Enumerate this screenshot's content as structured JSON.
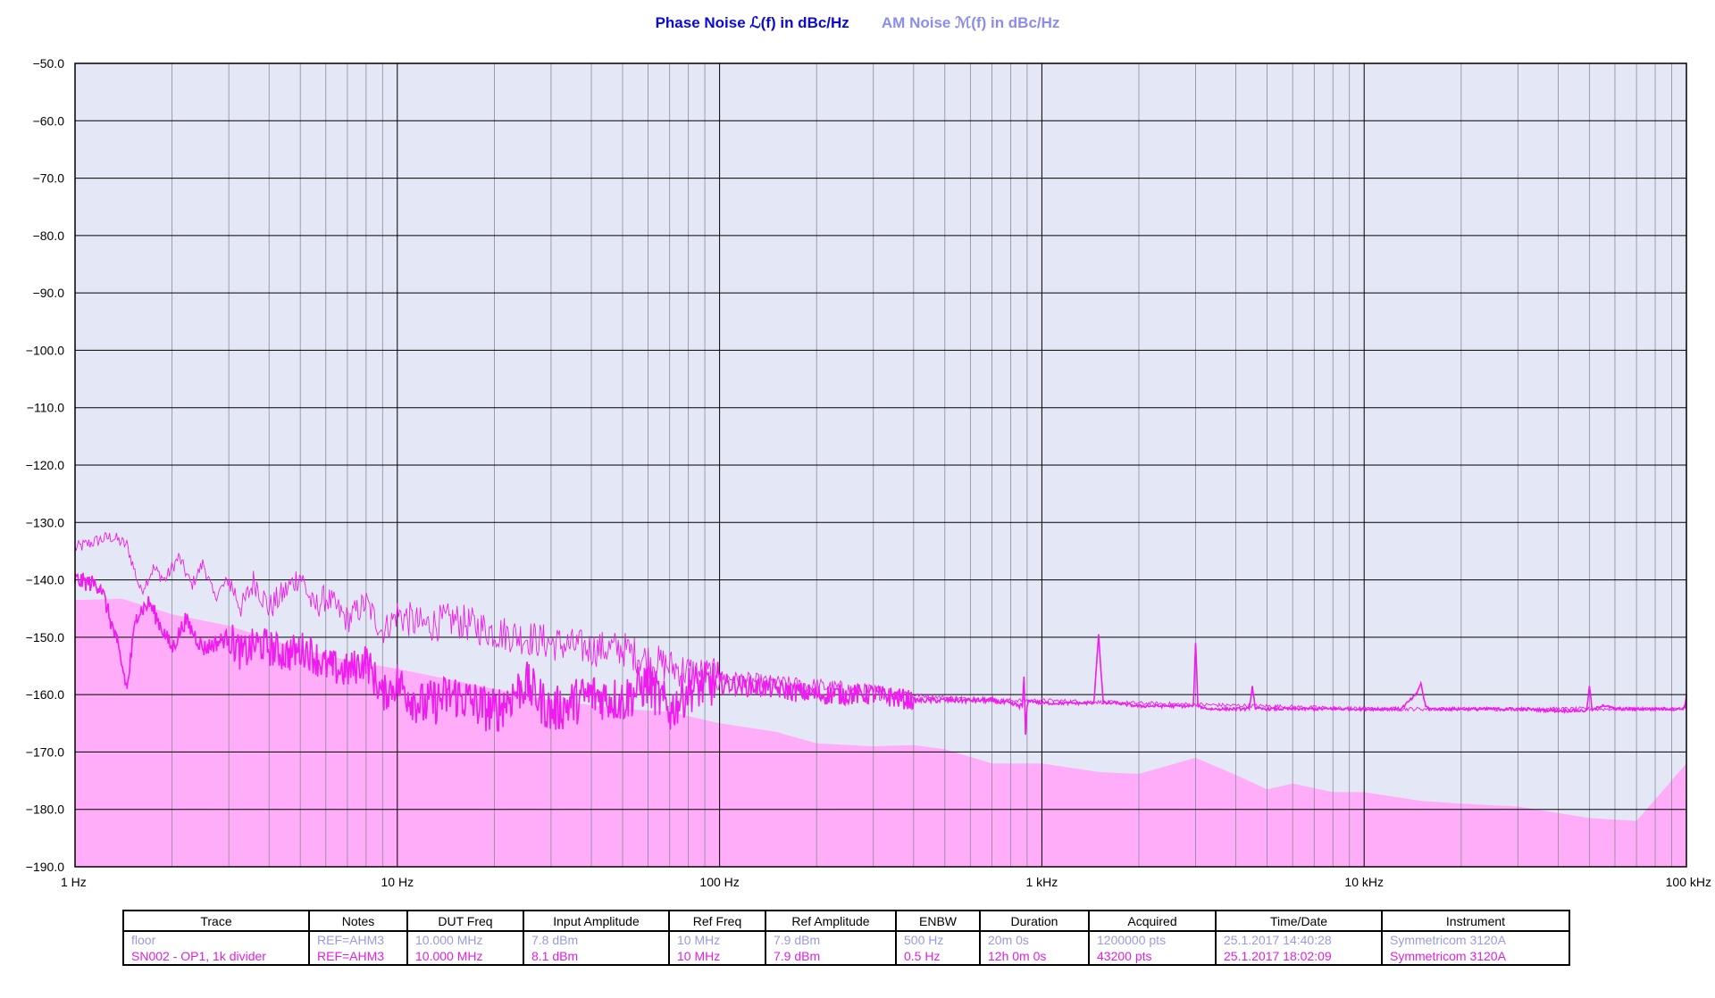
{
  "titles": {
    "phase_noise": "Phase Noise ℒ(f) in dBc/Hz",
    "am_noise": "AM Noise ℳ(f) in dBc/Hz"
  },
  "colors": {
    "phase_title": "#0a0ad8",
    "am_title": "#8c8cf0",
    "plot_bg": "#e4e8f6",
    "floor_fill": "#ffadf8",
    "trace": "#ee1cee",
    "grid": "#000000"
  },
  "chart_data": {
    "type": "line",
    "x_scale": "log",
    "xlim": [
      1,
      100000
    ],
    "ylim": [
      -190,
      -50
    ],
    "x_ticks": [
      {
        "value": 1,
        "label": "1 Hz"
      },
      {
        "value": 10,
        "label": "10 Hz"
      },
      {
        "value": 100,
        "label": "100 Hz"
      },
      {
        "value": 1000,
        "label": "1 kHz"
      },
      {
        "value": 10000,
        "label": "10 kHz"
      },
      {
        "value": 100000,
        "label": "100 kHz"
      }
    ],
    "y_ticks": [
      {
        "value": -50,
        "label": "−50.0"
      },
      {
        "value": -60,
        "label": "−60.0"
      },
      {
        "value": -70,
        "label": "−70.0"
      },
      {
        "value": -80,
        "label": "−80.0"
      },
      {
        "value": -90,
        "label": "−90.0"
      },
      {
        "value": -100,
        "label": "−100.0"
      },
      {
        "value": -110,
        "label": "−110.0"
      },
      {
        "value": -120,
        "label": "−120.0"
      },
      {
        "value": -130,
        "label": "−130.0"
      },
      {
        "value": -140,
        "label": "−140.0"
      },
      {
        "value": -150,
        "label": "−150.0"
      },
      {
        "value": -160,
        "label": "−160.0"
      },
      {
        "value": -170,
        "label": "−170.0"
      },
      {
        "value": -180,
        "label": "−180.0"
      },
      {
        "value": -190,
        "label": "−190.0"
      }
    ],
    "grid": true,
    "series": [
      {
        "name": "floor",
        "style": "filled-area",
        "x": [
          1,
          1.4,
          2,
          3,
          5,
          7,
          10,
          15,
          20,
          30,
          50,
          70,
          100,
          150,
          200,
          300,
          400,
          500,
          700,
          1000,
          1500,
          2000,
          3000,
          4000,
          5000,
          6000,
          8000,
          10000,
          15000,
          20000,
          30000,
          50000,
          70000,
          100000
        ],
        "y": [
          -143.5,
          -143.3,
          -146,
          -148,
          -152,
          -154,
          -155.5,
          -157.5,
          -159,
          -161,
          -162.5,
          -163,
          -165,
          -166.5,
          -168.5,
          -169,
          -168.8,
          -169.5,
          -172,
          -172,
          -173.5,
          -173.8,
          -171,
          -174,
          -176.5,
          -175.5,
          -177,
          -177,
          -178.5,
          -179,
          -179.5,
          -181.5,
          -182,
          -172
        ]
      },
      {
        "name": "SN002 - OP1, 1k divider",
        "style": "line",
        "x": [
          1,
          1.2,
          1.35,
          1.45,
          1.55,
          1.7,
          2,
          2.2,
          2.5,
          3,
          3.3,
          3.7,
          4.5,
          5.2,
          6,
          7,
          8,
          9,
          10,
          12,
          15,
          20,
          25,
          30,
          40,
          50,
          60,
          70,
          80,
          100,
          150,
          200,
          300,
          400,
          500,
          700,
          870,
          880,
          890,
          900,
          910,
          1000,
          1200,
          1450,
          1500,
          1550,
          1700,
          2000,
          2500,
          2950,
          3000,
          3050,
          3300,
          4000,
          4400,
          4500,
          4600,
          5000,
          6000,
          7000,
          8000,
          10000,
          13000,
          14500,
          15000,
          15500,
          16000,
          20000,
          30000,
          40000,
          49000,
          50000,
          51000,
          55000,
          60000,
          70000,
          80000,
          90000,
          97000,
          99000,
          100000
        ],
        "y": [
          -140,
          -141,
          -151,
          -159,
          -146,
          -144,
          -152,
          -147,
          -152,
          -150,
          -153,
          -151,
          -153,
          -152,
          -155,
          -156,
          -154,
          -160,
          -158,
          -162,
          -160,
          -163,
          -158,
          -163,
          -160,
          -161,
          -158,
          -163,
          -159,
          -158,
          -159,
          -160,
          -160,
          -161,
          -161,
          -161,
          -162,
          -157,
          -167,
          -162,
          -161,
          -161.5,
          -161.5,
          -161.5,
          -149.5,
          -161.5,
          -161.5,
          -162,
          -162,
          -162,
          -151,
          -162,
          -162.5,
          -162.5,
          -162.5,
          -158.5,
          -162.5,
          -162.5,
          -162.5,
          -162.5,
          -162.5,
          -162.5,
          -162.5,
          -160,
          -158,
          -162,
          -162.5,
          -162.5,
          -162.5,
          -162.8,
          -162.8,
          -158.5,
          -162.8,
          -161.8,
          -162.5,
          -162.5,
          -162.5,
          -162.5,
          -162.5,
          -162,
          -160
        ]
      },
      {
        "name": "floor",
        "style": "thin-line",
        "x": [
          1,
          1.2,
          1.3,
          1.45,
          1.6,
          1.75,
          1.9,
          2.1,
          2.3,
          2.5,
          2.7,
          3,
          3.3,
          3.6,
          4,
          4.5,
          5,
          5.5,
          6,
          7,
          8,
          9,
          10,
          12,
          15,
          20,
          25,
          30,
          40,
          50,
          60,
          80,
          100,
          150,
          200,
          300,
          500,
          700,
          1000,
          2000,
          5000,
          10000,
          20000,
          50000,
          100000
        ],
        "y": [
          -134.5,
          -133,
          -132.5,
          -134,
          -142,
          -138,
          -140,
          -136,
          -141,
          -137,
          -143,
          -140,
          -145,
          -140,
          -145,
          -142,
          -139,
          -145,
          -143,
          -147,
          -144,
          -149,
          -146,
          -148,
          -147,
          -149,
          -150,
          -151,
          -152,
          -152,
          -154,
          -156,
          -157,
          -158,
          -158.5,
          -159.5,
          -160.5,
          -161,
          -161,
          -161.5,
          -162,
          -162.5,
          -162.5,
          -162.5,
          -162.5
        ]
      }
    ]
  },
  "table": {
    "headers": [
      "Trace",
      "Notes",
      "DUT Freq",
      "Input Amplitude",
      "Ref Freq",
      "Ref Amplitude",
      "ENBW",
      "Duration",
      "Acquired",
      "Time/Date",
      "Instrument"
    ],
    "rows": [
      [
        "floor",
        "REF=AHM3",
        "10.000 MHz",
        "7.8 dBm",
        "10 MHz",
        "7.9 dBm",
        "500 Hz",
        "20m 0s",
        "1200000 pts",
        "25.1.2017 14:40:28",
        "Symmetricom 3120A"
      ],
      [
        "SN002 - OP1, 1k divider",
        "REF=AHM3",
        "10.000 MHz",
        "8.1 dBm",
        "10 MHz",
        "7.9 dBm",
        "0.5 Hz",
        "12h 0m 0s",
        "43200 pts",
        "25.1.2017 18:02:09",
        "Symmetricom 3120A"
      ]
    ]
  }
}
